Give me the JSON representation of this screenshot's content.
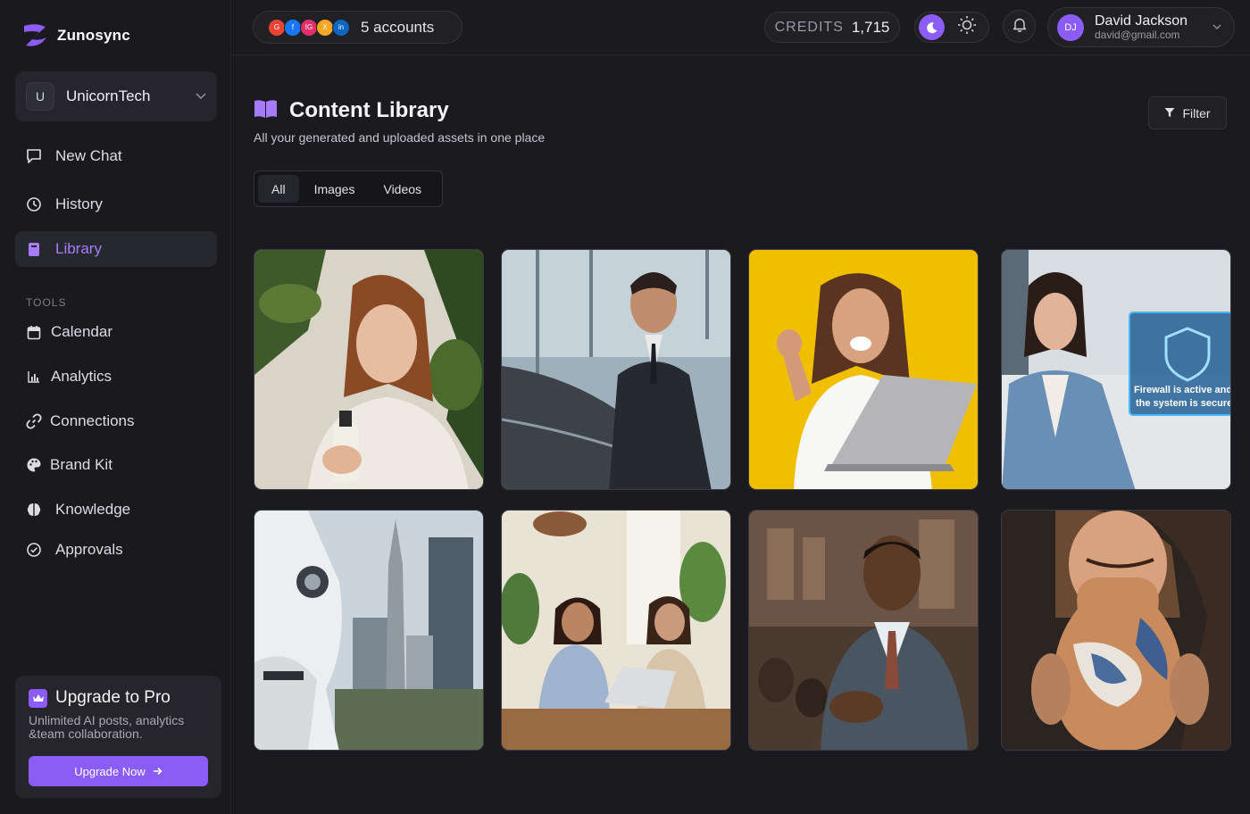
{
  "brand": {
    "name": "Zunosync",
    "color": "#8b5cf6"
  },
  "workspace": {
    "initial": "U",
    "name": "UnicornTech"
  },
  "nav": {
    "new_chat": "New Chat",
    "history": "History",
    "library": "Library"
  },
  "tools": {
    "label": "TOOLS",
    "calendar": "Calendar",
    "analytics": "Analytics",
    "connections": "Connections",
    "brand_kit": "Brand Kit",
    "knowledge": "Knowledge",
    "approvals": "Approvals"
  },
  "upgrade": {
    "title": "Upgrade to Pro",
    "description": "Unlimited AI posts, analytics &team collaboration.",
    "button": "Upgrade Now"
  },
  "topbar": {
    "accounts": [
      {
        "initial": "G",
        "color": "#ea4335"
      },
      {
        "initial": "f",
        "color": "#1877f2"
      },
      {
        "initial": "IG",
        "color": "#e1306c"
      },
      {
        "initial": "X",
        "color": "#f5a623"
      },
      {
        "initial": "in",
        "color": "#0a66c2"
      }
    ],
    "accounts_label": "5 accounts",
    "credits_label": "CREDITS",
    "credits_value": "1,715",
    "user": {
      "initials": "DJ",
      "name": "David Jackson",
      "email": "david@gmail.com"
    }
  },
  "page": {
    "title": "Content Library",
    "subtitle": "All your generated and uploaded assets in one place",
    "filter": "Filter",
    "tabs": [
      "All",
      "Images",
      "Videos"
    ],
    "active_tab": "All"
  },
  "library_items": [
    {
      "subject": "woman holding product bottle"
    },
    {
      "subject": "man in suit beside car"
    },
    {
      "subject": "excited woman with laptop"
    },
    {
      "subject": "businesswoman with security shield",
      "overlay_line1": "Firewall is active and",
      "overlay_line2": "the system is secure"
    },
    {
      "subject": "robot overlooking city"
    },
    {
      "subject": "two women working on laptop"
    },
    {
      "subject": "smiling man speaking"
    },
    {
      "subject": "woman holding vase"
    }
  ]
}
